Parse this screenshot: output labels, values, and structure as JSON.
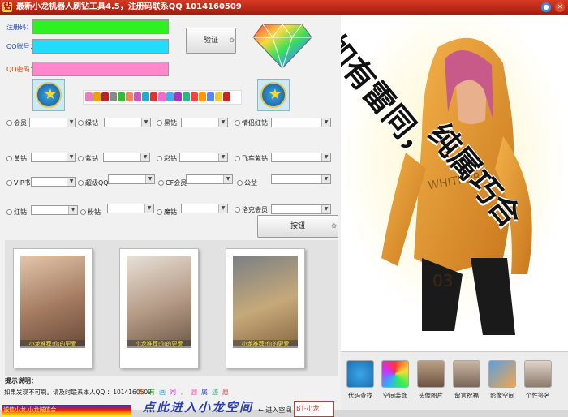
{
  "title": "最新小龙机器人刷钻工具4.5，注册码联系QQ 1014160509",
  "form": {
    "reg_label": "注册码：",
    "qq_label": "QQ账号：",
    "pwd_label": "QQ密码：",
    "verify_btn": "验证",
    "reg_color": "#2ef220",
    "qq_color": "#22dcff",
    "pwd_color": "#ff88cc"
  },
  "options": [
    {
      "label": "会员"
    },
    {
      "label": "绿钻"
    },
    {
      "label": "黑钻"
    },
    {
      "label": "情侣红钻"
    },
    {
      "label": "黄钻"
    },
    {
      "label": "紫钻"
    },
    {
      "label": "彩钻"
    },
    {
      "label": "飞车紫钻"
    },
    {
      "label": "VIP书"
    },
    {
      "label": "超级QQ"
    },
    {
      "label": "CF会员"
    },
    {
      "label": "公益"
    },
    {
      "label": "红钻"
    },
    {
      "label": "粉钻"
    },
    {
      "label": "魔钻"
    },
    {
      "label": "洛克会员"
    }
  ],
  "action_btn": "按钮",
  "photo_captions": [
    "小龙推荐!你的更爱",
    "小龙推荐!你的更爱",
    "小龙推荐!你的更爱"
  ],
  "hint_title": "提示说明：",
  "notice": "如果发现不可刷。请及时联系本人QQ ：1014160509",
  "colorful": [
    "知",
    "有",
    "画",
    "同",
    "，",
    "圆",
    "属",
    "迹",
    "愿"
  ],
  "gradbar_text": "诚信小龙,小龙诚信合",
  "callig_text": "点此进入小龙空间",
  "enter_space": "← 进入空间",
  "space_input": "BT-小龙",
  "right_text_1": "如有雷同，",
  "right_text_2": "纯属巧合",
  "tools": [
    {
      "label": "代码查找"
    },
    {
      "label": "空间装饰"
    },
    {
      "label": "头像图片"
    },
    {
      "label": "留言祝福"
    },
    {
      "label": "影像空间"
    },
    {
      "label": "个性签名"
    }
  ]
}
